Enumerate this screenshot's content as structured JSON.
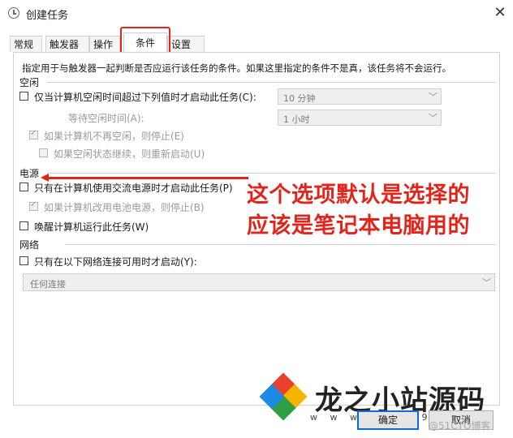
{
  "window": {
    "title": "创建任务",
    "close_glyph": "✕"
  },
  "tabs": [
    "常规",
    "触发器",
    "操作",
    "条件",
    "设置"
  ],
  "active_tab": "条件",
  "description": "指定用于与触发器一起判断是否应运行该任务的条件。如果这里指定的条件不是真，该任务将不会运行。",
  "idle": {
    "section": "空闲",
    "start_label": "仅当计算机空闲时间超过下列值时才启动此任务(C):",
    "start_value": "10 分钟",
    "wait_label": "等待空闲时间(A):",
    "wait_value": "1 小时",
    "stop_label": "如果计算机不再空闲，则停止(E)",
    "restart_label": "如果空闲状态继续，则重新启动(U)"
  },
  "power": {
    "section": "电源",
    "ac_label": "只有在计算机使用交流电源时才启动此任务(P)",
    "battery_label": "如果计算机改用电池电源，则停止(B)",
    "wake_label": "唤醒计算机运行此任务(W)"
  },
  "network": {
    "section": "网络",
    "only_label": "只有在以下网络连接可用时才启动(Y):",
    "connection_value": "任何连接"
  },
  "annotation": {
    "line1": "这个选项默认是选择的",
    "line2": "应该是笔记本电脑用的",
    "color": "#e3241b"
  },
  "buttons": {
    "ok": "确定",
    "cancel": "取消"
  },
  "watermark": {
    "brand": "龙之小站源码",
    "url": "w w w . 6 3 9 1 8 .",
    "blog": "@51CTO博客",
    "logo_colors": [
      "#e8412c",
      "#f5b400",
      "#2f9e44",
      "#1e88e5"
    ]
  }
}
